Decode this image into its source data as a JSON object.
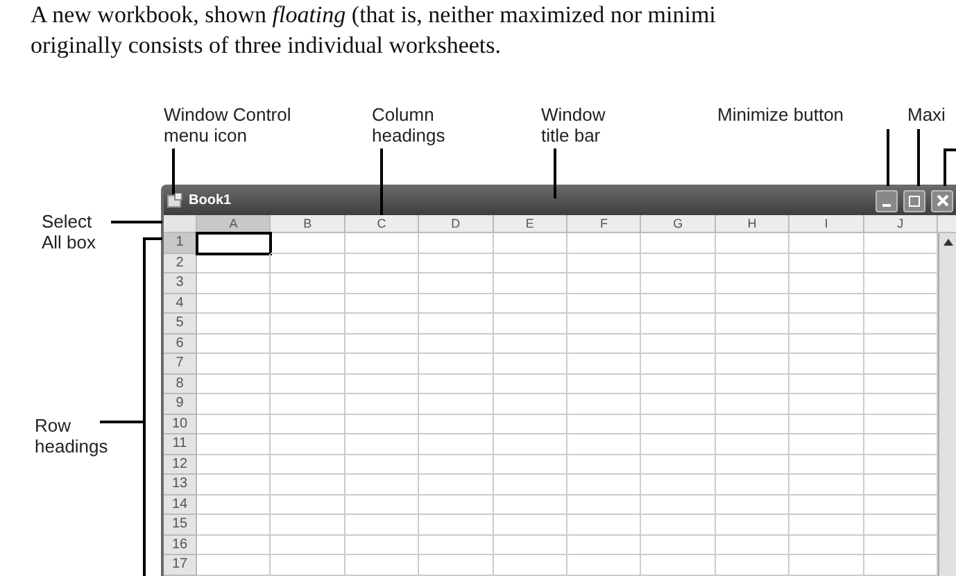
{
  "caption": {
    "lines": [
      "A new workbook, shown *floating* (that is, neither maximized nor minimi",
      "originally consists of three individual worksheets."
    ]
  },
  "callouts": [
    {
      "text": "Window Control\nmenu icon"
    },
    {
      "text": "Column\nheadings"
    },
    {
      "text": "Window\ntitle bar"
    },
    {
      "text": "Minimize button"
    },
    {
      "text": "Maxi"
    },
    {
      "text": "Select\nAll box"
    },
    {
      "text": "Row\nheadings"
    }
  ],
  "window": {
    "title": "Book1",
    "columns": [
      {
        "label": "A",
        "selected": true
      },
      {
        "label": "B",
        "selected": false
      },
      {
        "label": "C",
        "selected": false
      },
      {
        "label": "D",
        "selected": false
      },
      {
        "label": "E",
        "selected": false
      },
      {
        "label": "F",
        "selected": false
      },
      {
        "label": "G",
        "selected": false
      },
      {
        "label": "H",
        "selected": false
      },
      {
        "label": "I",
        "selected": false
      },
      {
        "label": "J",
        "selected": false
      }
    ],
    "rows": [
      {
        "label": "1",
        "selected": true
      },
      {
        "label": "2",
        "selected": false
      },
      {
        "label": "3",
        "selected": false
      },
      {
        "label": "4",
        "selected": false
      },
      {
        "label": "5",
        "selected": false
      },
      {
        "label": "6",
        "selected": false
      },
      {
        "label": "7",
        "selected": false
      },
      {
        "label": "8",
        "selected": false
      },
      {
        "label": "9",
        "selected": false
      },
      {
        "label": "10",
        "selected": false
      },
      {
        "label": "11",
        "selected": false
      },
      {
        "label": "12",
        "selected": false
      },
      {
        "label": "13",
        "selected": false
      },
      {
        "label": "14",
        "selected": false
      },
      {
        "label": "15",
        "selected": false
      },
      {
        "label": "16",
        "selected": false
      },
      {
        "label": "17",
        "selected": false
      }
    ]
  }
}
